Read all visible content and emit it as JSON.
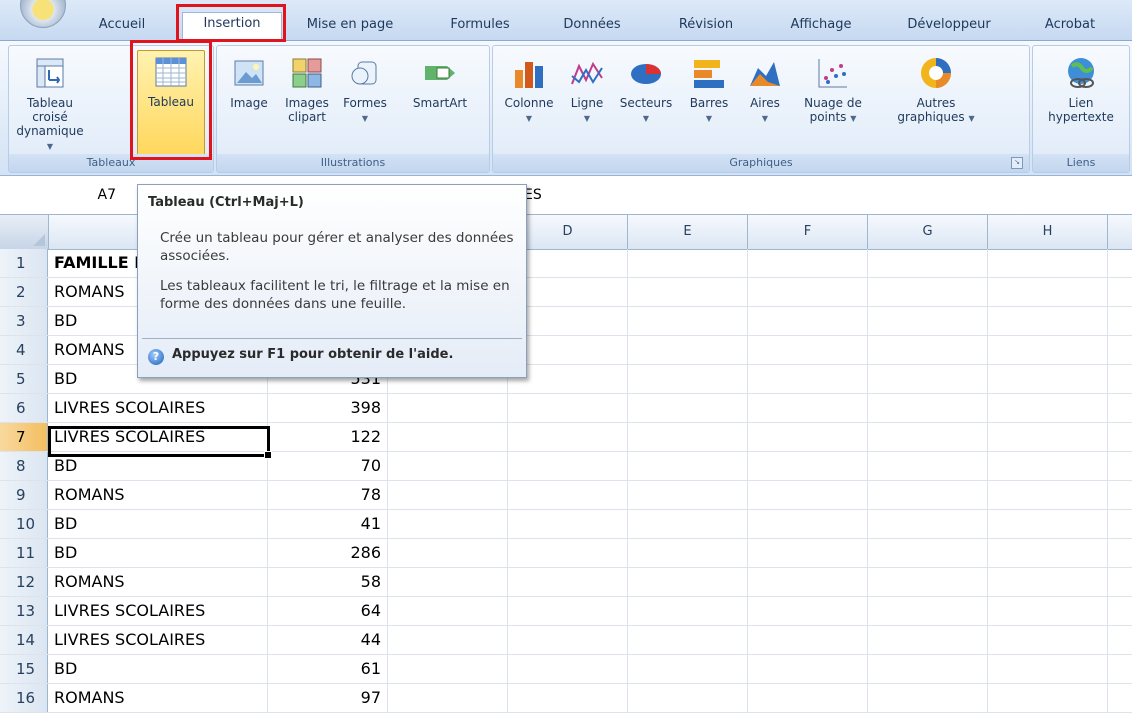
{
  "ribbon_tabs": [
    "Accueil",
    "Insertion",
    "Mise en page",
    "Formules",
    "Données",
    "Révision",
    "Affichage",
    "Développeur",
    "Acrobat"
  ],
  "active_tab": "Insertion",
  "groups": {
    "tableaux": {
      "label": "Tableaux",
      "buttons": [
        {
          "label": "Tableau croisé",
          "label2": "dynamique",
          "icon": "pivot-table-icon"
        },
        {
          "label": "Tableau",
          "label2": "",
          "icon": "table-icon",
          "highlighted": true
        }
      ]
    },
    "illustrations": {
      "label": "Illustrations",
      "buttons": [
        {
          "label": "Image",
          "label2": "",
          "icon": "image-icon"
        },
        {
          "label": "Images",
          "label2": "clipart",
          "icon": "clipart-icon"
        },
        {
          "label": "Formes",
          "label2": "",
          "icon": "shapes-icon"
        },
        {
          "label": "SmartArt",
          "label2": "",
          "icon": "smartart-icon"
        }
      ]
    },
    "graphiques": {
      "label": "Graphiques",
      "buttons": [
        {
          "label": "Colonne",
          "label2": "",
          "icon": "column-chart-icon"
        },
        {
          "label": "Ligne",
          "label2": "",
          "icon": "line-chart-icon"
        },
        {
          "label": "Secteurs",
          "label2": "",
          "icon": "pie-chart-icon"
        },
        {
          "label": "Barres",
          "label2": "",
          "icon": "bar-chart-icon"
        },
        {
          "label": "Aires",
          "label2": "",
          "icon": "area-chart-icon"
        },
        {
          "label": "Nuage de",
          "label2": "points",
          "icon": "scatter-chart-icon"
        },
        {
          "label": "Autres",
          "label2": "graphiques",
          "icon": "other-charts-icon"
        }
      ]
    },
    "liens": {
      "label": "Liens",
      "buttons": [
        {
          "label": "Lien",
          "label2": "hypertexte",
          "icon": "hyperlink-icon"
        }
      ]
    }
  },
  "name_box": "A7",
  "formula_visible_text": "ES",
  "tooltip": {
    "title": "Tableau (Ctrl+Maj+L)",
    "para1": "Crée un tableau pour gérer et analyser des données associées.",
    "para2": "Les tableaux facilitent le tri, le filtrage et la mise en forme des données dans une feuille.",
    "help": "Appuyez sur F1 pour obtenir de l'aide."
  },
  "column_headers": [
    "D",
    "E",
    "F",
    "G",
    "H"
  ],
  "rows": [
    {
      "n": "1",
      "a": "FAMILLE I",
      "b": ""
    },
    {
      "n": "2",
      "a": "ROMANS",
      "b": ""
    },
    {
      "n": "3",
      "a": "BD",
      "b": ""
    },
    {
      "n": "4",
      "a": "ROMANS",
      "b": ""
    },
    {
      "n": "5",
      "a": "BD",
      "b": "531"
    },
    {
      "n": "6",
      "a": "LIVRES SCOLAIRES",
      "b": "398"
    },
    {
      "n": "7",
      "a": "LIVRES SCOLAIRES",
      "b": "122"
    },
    {
      "n": "8",
      "a": "BD",
      "b": "70"
    },
    {
      "n": "9",
      "a": "ROMANS",
      "b": "78"
    },
    {
      "n": "10",
      "a": "BD",
      "b": "41"
    },
    {
      "n": "11",
      "a": "BD",
      "b": "286"
    },
    {
      "n": "12",
      "a": "ROMANS",
      "b": "58"
    },
    {
      "n": "13",
      "a": "LIVRES SCOLAIRES",
      "b": "64"
    },
    {
      "n": "14",
      "a": "LIVRES SCOLAIRES",
      "b": "44"
    },
    {
      "n": "15",
      "a": "BD",
      "b": "61"
    },
    {
      "n": "16",
      "a": "ROMANS",
      "b": "97"
    }
  ]
}
